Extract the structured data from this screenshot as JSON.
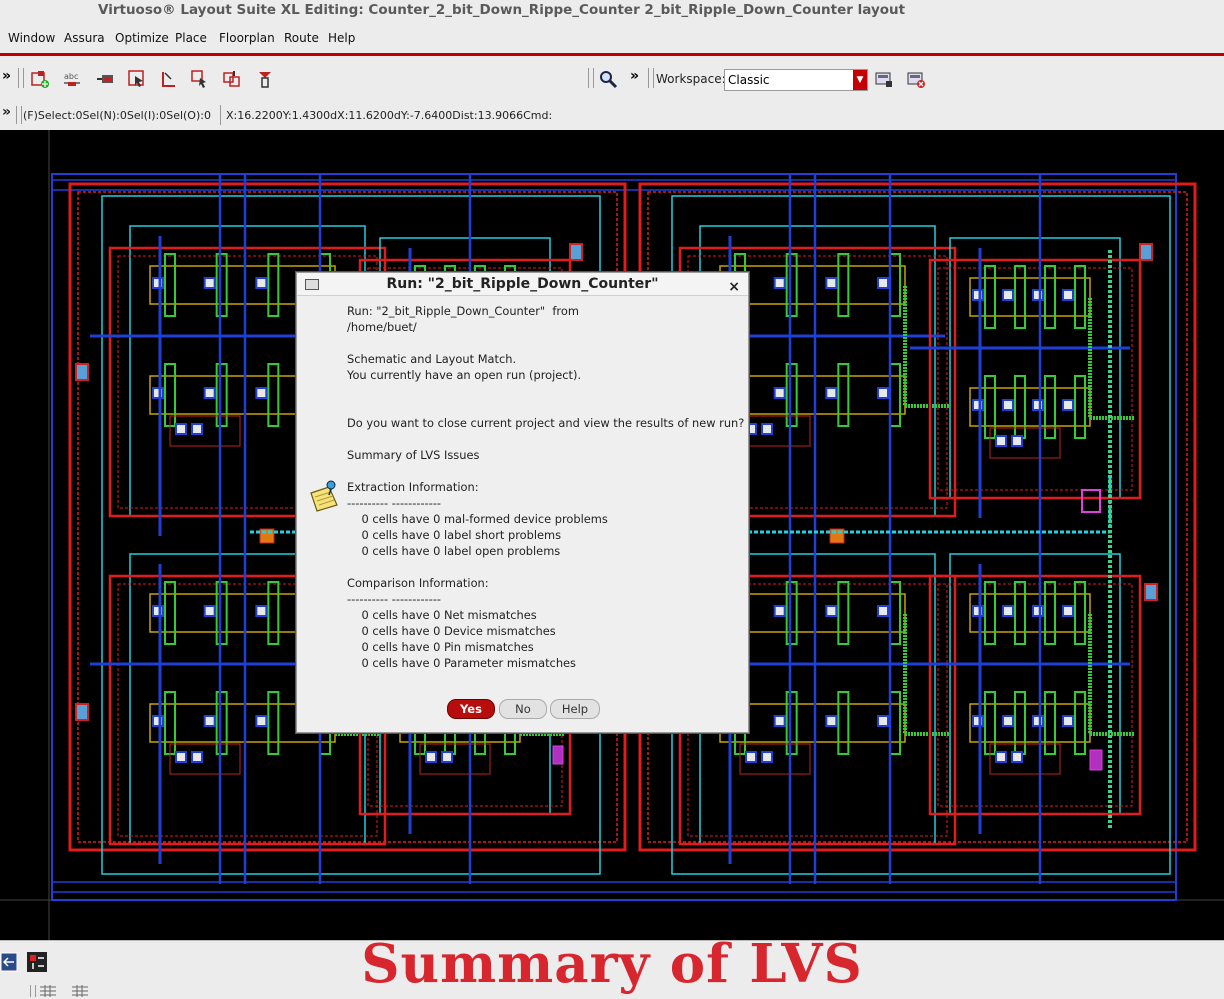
{
  "window": {
    "title": "Virtuoso® Layout Suite XL Editing: Counter_2_bit_Down_Rippe_Counter 2_bit_Ripple_Down_Counter layout"
  },
  "menu": [
    "Window",
    "Assura",
    "Optimize",
    "Place",
    "Floorplan",
    "Route",
    "Help"
  ],
  "toolbar": {
    "overflow_left": "»",
    "overflow_mid": "»",
    "workspace_label": "Workspace:",
    "workspace_value": "Classic",
    "icons": [
      "create-instance-icon",
      "create-label-icon",
      "create-pin-icon",
      "select-icon",
      "ruler-icon",
      "move-icon",
      "stretch-icon",
      "copy-icon",
      "zoom-icon",
      "workspace-save-icon",
      "workspace-delete-icon"
    ]
  },
  "status": {
    "overflow": "»",
    "selection": "(F)Select:0Sel(N):0Sel(I):0Sel(O):0",
    "coords": "X:16.2200Y:1.4300dX:11.6200dY:-7.6400Dist:13.9066Cmd:"
  },
  "dialog": {
    "title": "Run: \"2_bit_Ripple_Down_Counter\"",
    "close": "×",
    "icon": "note-pin-icon",
    "lines": [
      "Run: \"2_bit_Ripple_Down_Counter\"  from",
      "/home/buet/",
      "",
      "Schematic and Layout Match.",
      "You currently have an open run (project).",
      "",
      "",
      "Do you want to close current project and view the results of new run?",
      "",
      "Summary of LVS Issues",
      "",
      "Extraction Information:",
      "---------- ------------",
      "    0 cells have 0 mal-formed device problems",
      "    0 cells have 0 label short problems",
      "    0 cells have 0 label open problems",
      "",
      "Comparison Information:",
      "---------- ------------",
      "    0 cells have 0 Net mismatches",
      "    0 cells have 0 Device mismatches",
      "    0 cells have 0 Pin mismatches",
      "    0 cells have 0 Parameter mismatches"
    ],
    "buttons": {
      "yes": "Yes",
      "no": "No",
      "help": "Help"
    }
  },
  "caption": "Summary of LVS",
  "colors": {
    "accent": "#c00000",
    "metal1": "#1f3fd6",
    "poly": "#e01c1c",
    "nwell": "#22d0e0",
    "diff": "#33cc33",
    "contact": "#e8e8e8"
  }
}
